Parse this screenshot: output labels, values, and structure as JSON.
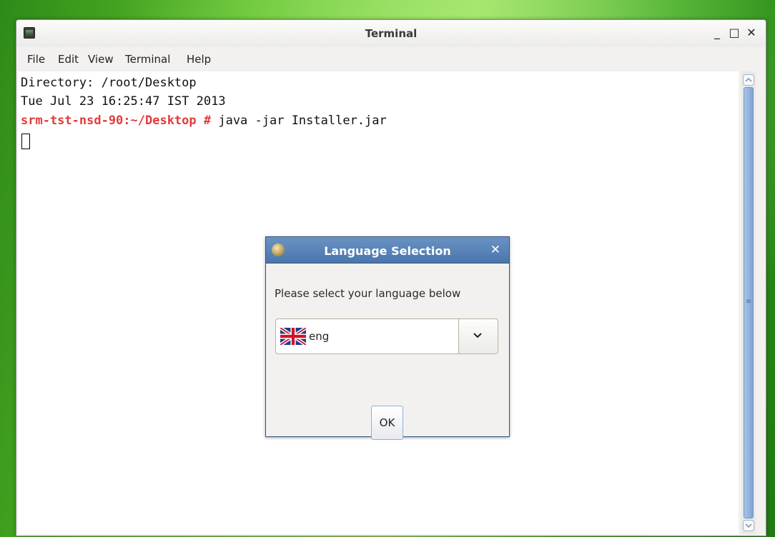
{
  "window": {
    "title": "Terminal",
    "controls": {
      "minimize": "_",
      "maximize": "□",
      "close": "✕"
    }
  },
  "menu": [
    "File",
    "Edit",
    "View",
    "Terminal",
    "Help"
  ],
  "terminal": {
    "line1": "Directory: /root/Desktop",
    "line2": "Tue Jul 23 16:25:47 IST 2013",
    "prompt": "srm-tst-nsd-90:~/Desktop #",
    "command": " java -jar Installer.jar"
  },
  "scrollbar": {
    "up_icon": "chevron-up-icon",
    "down_icon": "chevron-down-icon"
  },
  "dialog": {
    "title": "Language Selection",
    "close": "✕",
    "message": "Please select your language below",
    "selected_language": "eng",
    "flag": "uk-flag-icon",
    "ok_label": "OK"
  },
  "colors": {
    "prompt": "#e23b3b",
    "dialog_title": "#4a76ad",
    "scroll_thumb": "#8fb2dc",
    "desktop": "#5fc12a"
  }
}
